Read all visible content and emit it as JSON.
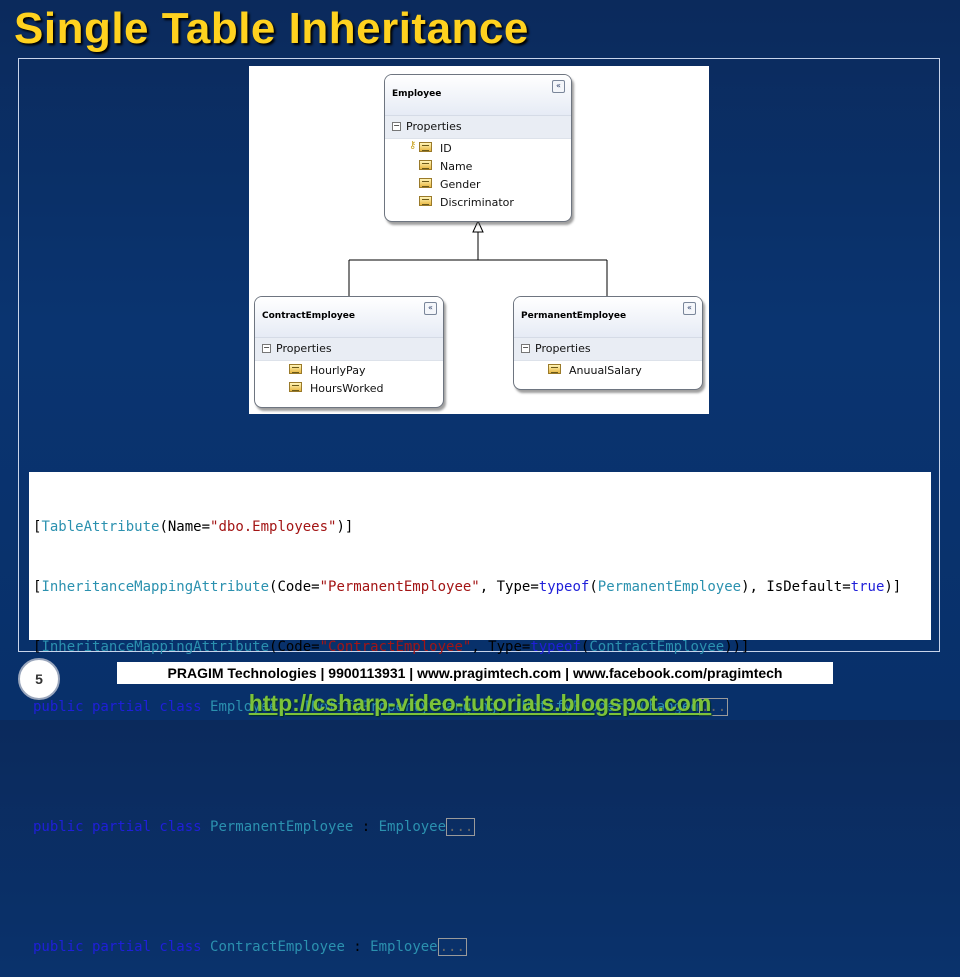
{
  "slide": {
    "title": "Single Table Inheritance",
    "page_number": "5",
    "footer": "PRAGIM Technologies | 9900113931 | www.pragimtech.com | www.facebook.com/pragimtech",
    "url": "http://csharp-video-tutorials.blogspot.com"
  },
  "diagram": {
    "collapse_glyph": "«",
    "section_label": "Properties",
    "section_toggle": "−",
    "employee": {
      "name": "Employee",
      "properties": [
        "ID",
        "Name",
        "Gender",
        "Discriminator"
      ],
      "key_icon": "key-icon"
    },
    "contract": {
      "name": "ContractEmployee",
      "properties": [
        "HourlyPay",
        "HoursWorked"
      ]
    },
    "permanent": {
      "name": "PermanentEmployee",
      "properties": [
        "AnuualSalary"
      ]
    }
  },
  "code": {
    "l1": {
      "a": "[",
      "b": "TableAttribute",
      "c": "(Name=",
      "d": "\"dbo.Employees\"",
      "e": ")]"
    },
    "l2": {
      "a": "[",
      "b": "InheritanceMappingAttribute",
      "c": "(Code=",
      "d": "\"PermanentEmployee\"",
      "e": ", Type=",
      "f": "typeof",
      "g": "(",
      "h": "PermanentEmployee",
      "i": "), IsDefault=",
      "j": "true",
      "k": ")]"
    },
    "l3": {
      "a": "[",
      "b": "InheritanceMappingAttribute",
      "c": "(Code=",
      "d": "\"ContractEmployee\"",
      "e": ", Type=",
      "f": "typeof",
      "g": "(",
      "h": "ContractEmployee",
      "i": "))]"
    },
    "l4": {
      "a": "public partial class ",
      "b": "Employee",
      "c": " : ",
      "d": "INotifyPropertyChanging",
      "e": ", ",
      "f": "INotifyPropertyChanged",
      "g": "..."
    },
    "l5": {
      "a": "public partial class ",
      "b": "PermanentEmployee",
      "c": " : ",
      "d": "Employee",
      "e": "..."
    },
    "l6": {
      "a": "public partial class ",
      "b": "ContractEmployee",
      "c": " : ",
      "d": "Employee",
      "e": "..."
    }
  }
}
